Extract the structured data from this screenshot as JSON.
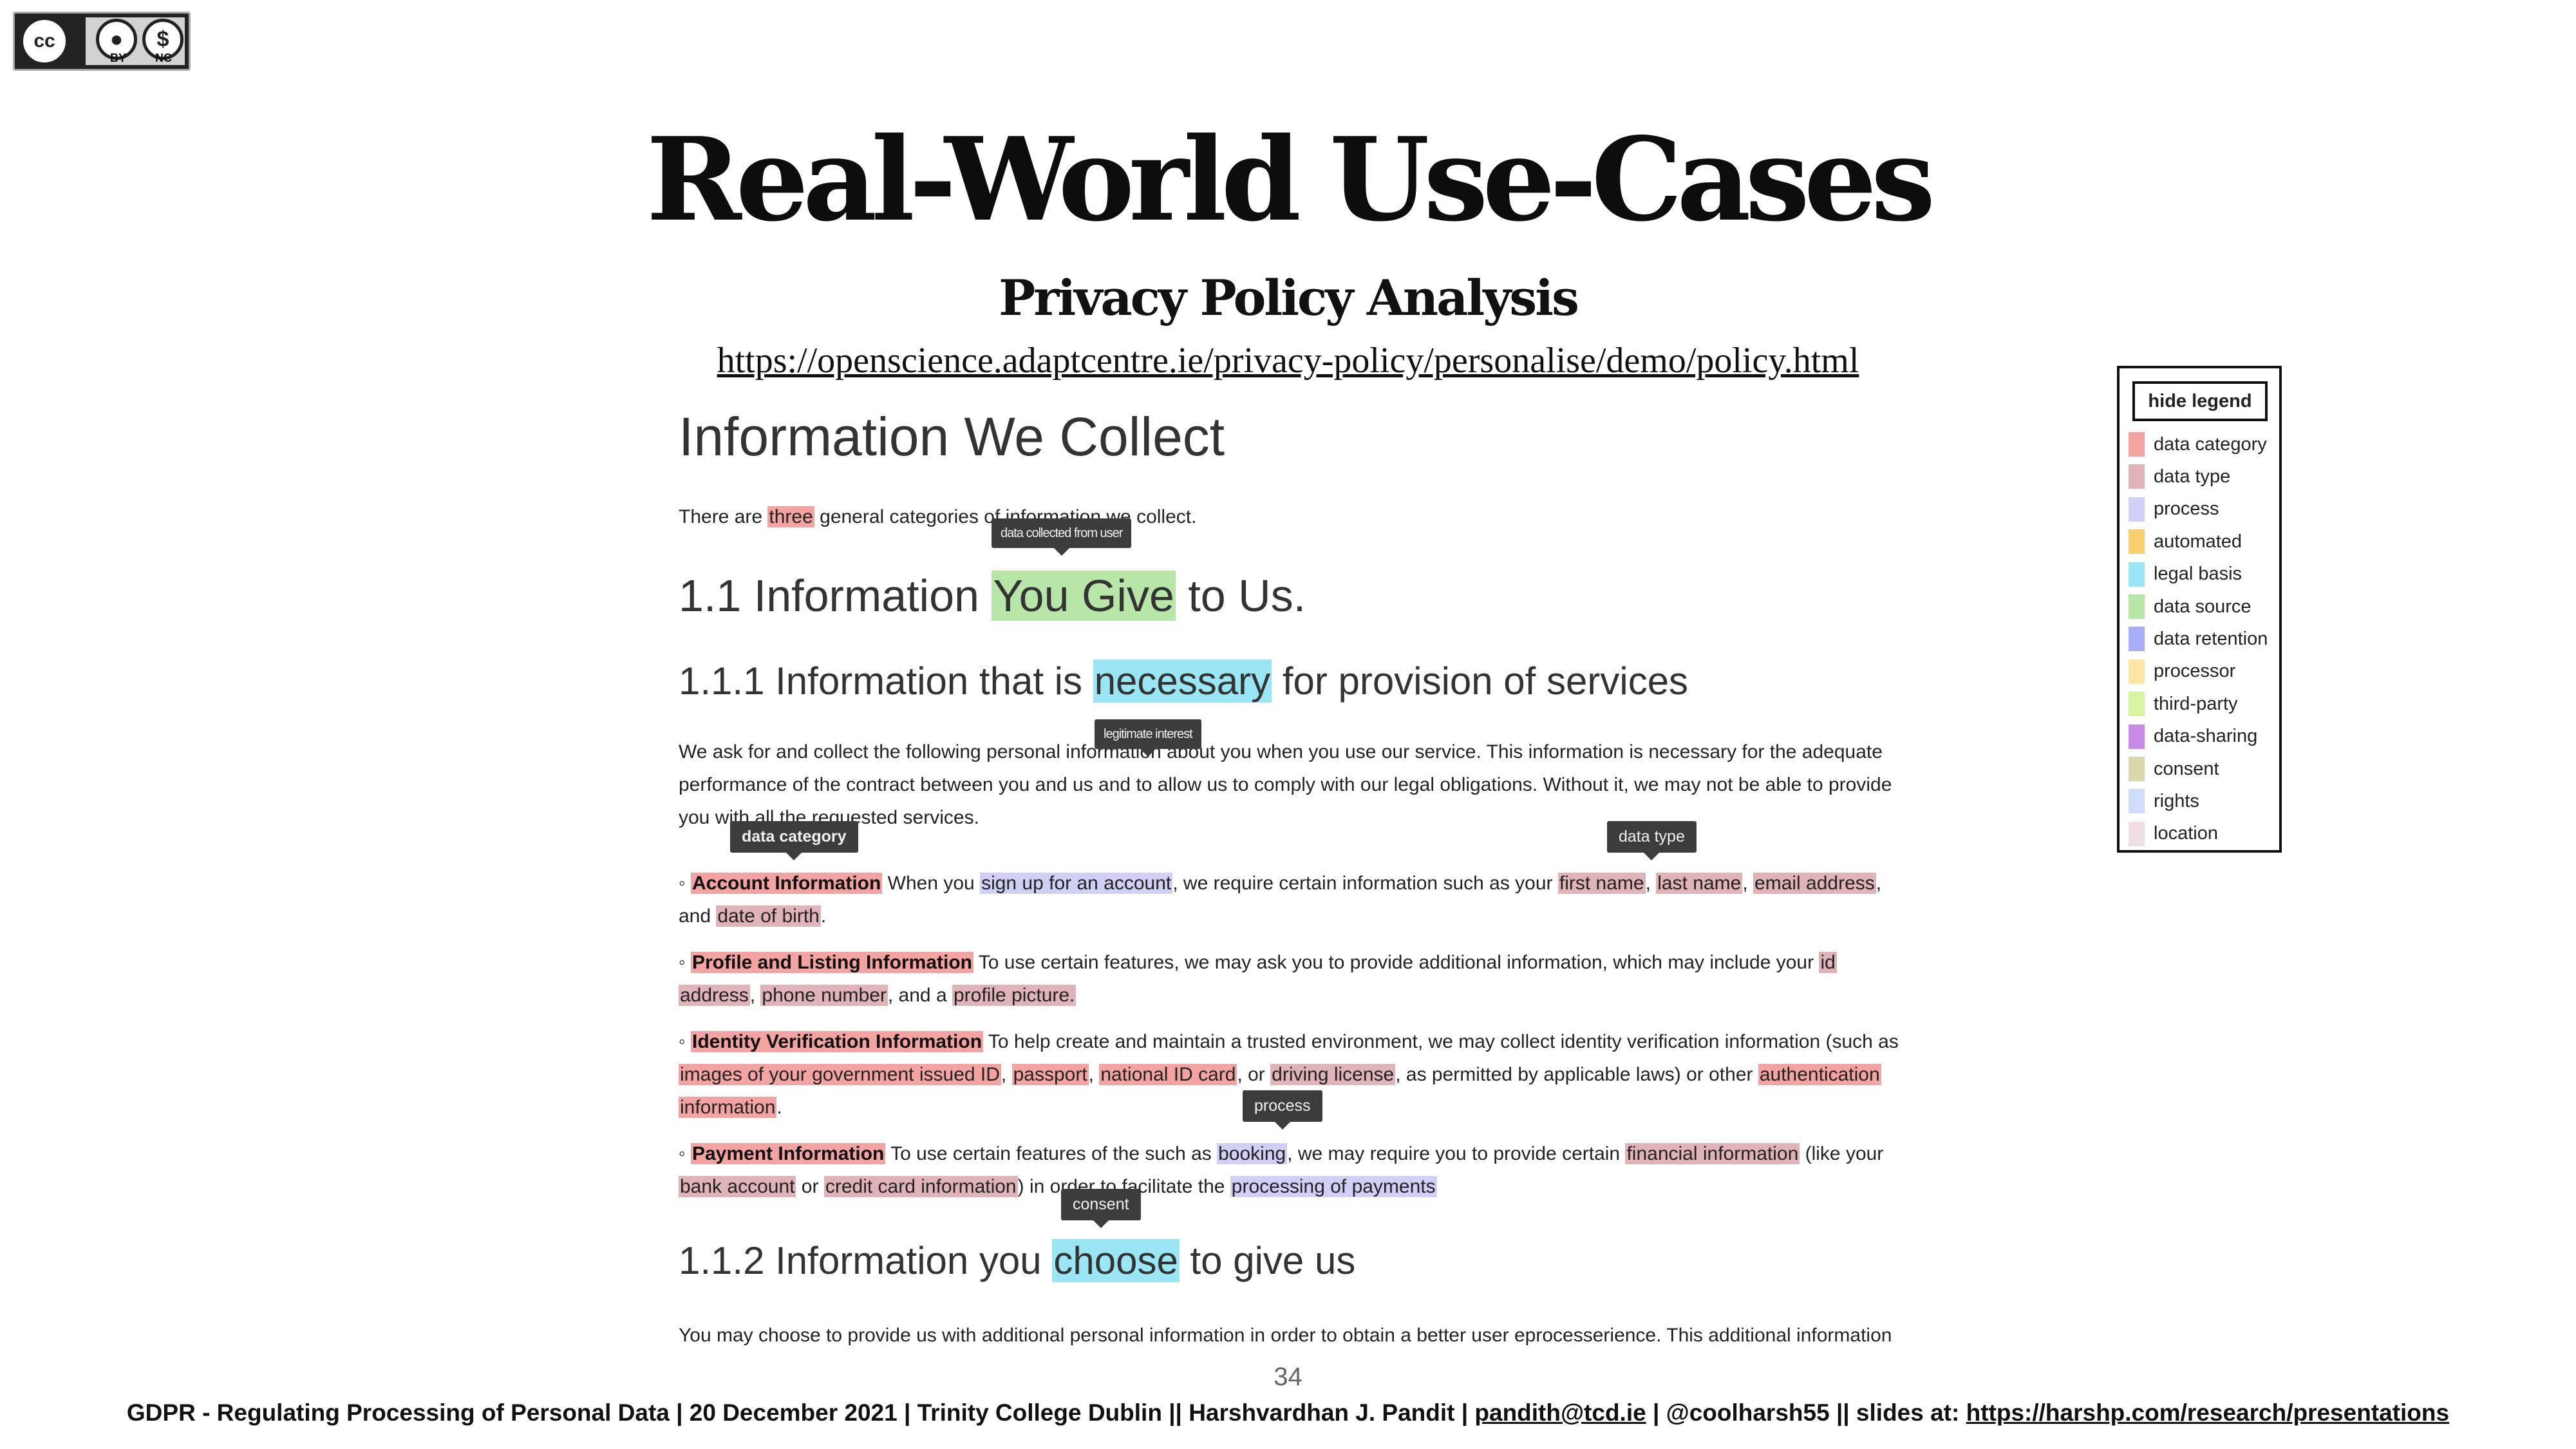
{
  "badge": {
    "by": "BY",
    "nc": "NC",
    "cc": "cc"
  },
  "title": "Real-World Use-Cases",
  "subtitle": "Privacy Policy Analysis",
  "url": "https://openscience.adaptcentre.ie/privacy-policy/personalise/demo/policy.html",
  "doc": {
    "h1": "Information We Collect",
    "intro": {
      "pre": "There are ",
      "three": "three",
      "post": " general categories of information we collect."
    },
    "h2": {
      "pre": "1.1 Information ",
      "hl": "You Give",
      "post": " to Us."
    },
    "h3a": {
      "pre": "1.1.1 Information that is ",
      "hl": "necessary",
      "post": " for provision of services"
    },
    "para1": {
      "line1": "We ask for and collect the following personal information about you when you use our service. This information is necessary for the adequate",
      "line2": "performance of the contract between you and us and to allow us to comply with our legal obligations. Without it, we may not be able to provide",
      "line3": "you with all the requested services."
    },
    "account": {
      "bullet": "◦",
      "label": "Account Information",
      "t1": " When you ",
      "signup": "sign up for an account",
      "t2": ", we require certain information such as your ",
      "first": "first name",
      "c1": ", ",
      "last": "last name",
      "c2": ", ",
      "email": "email address",
      "c3": ",",
      "and": "and ",
      "dob": "date of birth",
      "end": "."
    },
    "profile": {
      "bullet": "◦",
      "label": "Profile and Listing Information",
      "t1": " To use certain features, we may ask you to provide additional information, which may include your ",
      "id1": "id",
      "id2": "address",
      "c1": ", ",
      "phone": "phone number",
      "t2": ", and a ",
      "pic": "profile picture."
    },
    "identity": {
      "bullet": "◦",
      "label": "Identity Verification Information",
      "t1": " To help create and maintain a trusted environment, we may collect identity verification information (such as",
      "images": "images of your government issued ID",
      "c1": ", ",
      "passport": "passport",
      "c2": ", ",
      "nid": "national ID card",
      "t2": ", or ",
      "dl": "driving license",
      "t3": ", as permitted by applicable laws) or other ",
      "auth1": "authentication",
      "auth2": "information",
      "end": "."
    },
    "payment": {
      "bullet": "◦",
      "label": "Payment Information",
      "t1": " To use certain features of the such as ",
      "booking": "booking",
      "t2": ", we may require you to provide certain ",
      "fin": "financial information",
      "t3": " (like your",
      "bank": "bank account",
      "t4": " or ",
      "cc": "credit card information",
      "t5": ") in order to facilitate the ",
      "proc": "processing of payments"
    },
    "h3b": {
      "pre": "1.1.2 Information you ",
      "hl": "choose",
      "post": " to give us"
    },
    "para2": "You may choose to provide us with additional personal information in order to obtain a better user eprocesserience. This additional information"
  },
  "tooltips": {
    "data_collected": "data collected from user",
    "legit": "legitimate interest",
    "data_category": "data category",
    "data_type": "data type",
    "process": "process",
    "consent": "consent"
  },
  "legend": {
    "toggle": "hide legend",
    "items": [
      {
        "label": "data category",
        "color": "#f4a3a3"
      },
      {
        "label": "data type",
        "color": "#dfb3b7"
      },
      {
        "label": "process",
        "color": "#d0d0f7"
      },
      {
        "label": "automated",
        "color": "#f9cf72"
      },
      {
        "label": "legal basis",
        "color": "#9ae6f5"
      },
      {
        "label": "data source",
        "color": "#b8e6a8"
      },
      {
        "label": "data retention",
        "color": "#a8aef5"
      },
      {
        "label": "processor",
        "color": "#fbe6a6"
      },
      {
        "label": "third-party",
        "color": "#d8f5a2"
      },
      {
        "label": "data-sharing",
        "color": "#c98be8"
      },
      {
        "label": "consent",
        "color": "#d9d8ad"
      },
      {
        "label": "rights",
        "color": "#cfdcfa"
      },
      {
        "label": "location",
        "color": "#f1dde6"
      }
    ]
  },
  "page_number": "34",
  "footer": {
    "text": "GDPR - Regulating Processing of Personal Data | 20 December 2021 | Trinity College Dublin  || Harshvardhan J. Pandit | ",
    "email": "pandith@tcd.ie",
    "mid": " | @coolharsh55  || slides at: ",
    "link": "https://harshp.com/research/presentations"
  }
}
